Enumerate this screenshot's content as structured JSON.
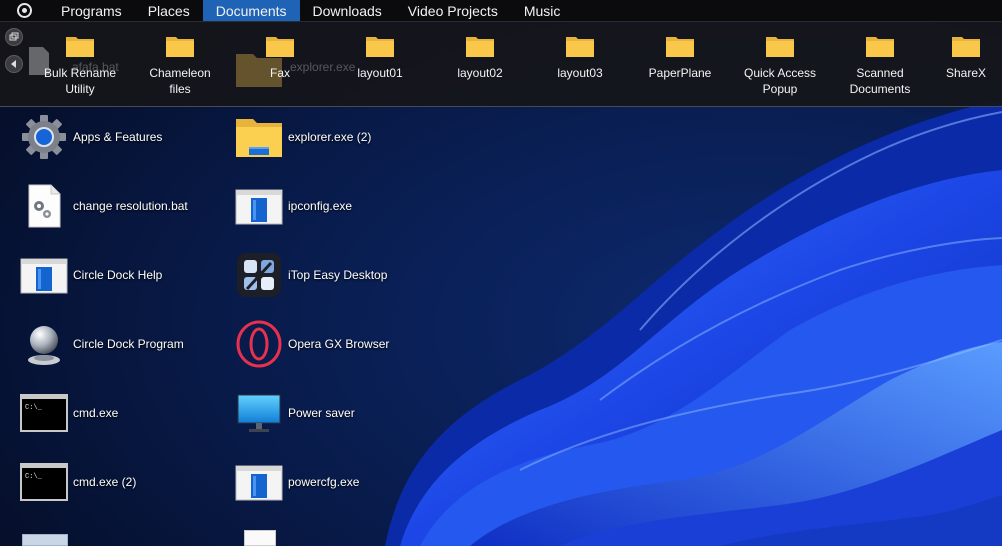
{
  "tabs": [
    {
      "label": "Programs"
    },
    {
      "label": "Places"
    },
    {
      "label": "Documents",
      "active": true
    },
    {
      "label": "Downloads"
    },
    {
      "label": "Video Projects"
    },
    {
      "label": "Music"
    }
  ],
  "shelf": {
    "ghost_labels": [
      "afafa.bat",
      "explorer.exe"
    ],
    "items": [
      {
        "label": "Bulk Rename\nUtility"
      },
      {
        "label": "Chameleon\nfiles"
      },
      {
        "label": "Fax"
      },
      {
        "label": "layout01"
      },
      {
        "label": "layout02"
      },
      {
        "label": "layout03"
      },
      {
        "label": "PaperPlane"
      },
      {
        "label": "Quick Access\nPopup"
      },
      {
        "label": "Scanned\nDocuments"
      },
      {
        "label": "ShareX"
      }
    ]
  },
  "desktop": {
    "left_column": [
      {
        "label": "Apps & Features",
        "icon": "gear-icon"
      },
      {
        "label": "change resolution.bat",
        "icon": "batch-file-icon"
      },
      {
        "label": "Circle Dock Help",
        "icon": "window-app-icon"
      },
      {
        "label": "Circle Dock Program",
        "icon": "crystal-ball-icon"
      },
      {
        "label": "cmd.exe",
        "icon": "terminal-icon"
      },
      {
        "label": "cmd.exe (2)",
        "icon": "terminal-icon"
      }
    ],
    "right_column": [
      {
        "label": "explorer.exe (2)",
        "icon": "file-explorer-icon"
      },
      {
        "label": "ipconfig.exe",
        "icon": "window-app-icon"
      },
      {
        "label": "iTop Easy Desktop",
        "icon": "itop-icon"
      },
      {
        "label": "Opera GX Browser",
        "icon": "opera-gx-icon"
      },
      {
        "label": "Power saver",
        "icon": "monitor-icon"
      },
      {
        "label": "powercfg.exe",
        "icon": "window-app-icon"
      }
    ]
  },
  "colors": {
    "active_tab": "#1f63b6",
    "folder": "#f9c84a",
    "wallpaper_blue": "#1e4df0",
    "background": "#081431"
  }
}
